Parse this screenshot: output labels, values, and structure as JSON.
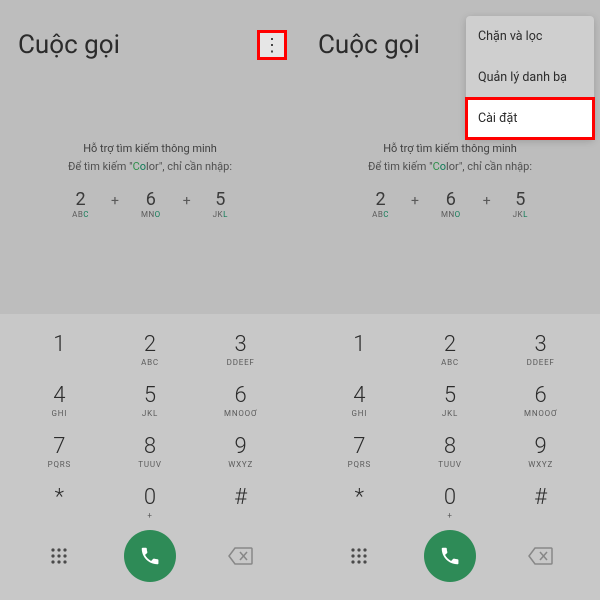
{
  "title": "Cuộc gọi",
  "hint": {
    "line1": "Hỗ trợ tìm kiếm thông minh",
    "line2_a": "Để tìm kiếm \"",
    "line2_b": "C",
    "line2_c": "o",
    "line2_d": "l",
    "line2_e": "or\", chỉ cần nhập:"
  },
  "example": [
    {
      "num": "2",
      "letters_pre": "AB",
      "letters_hi": "C",
      "letters_post": ""
    },
    {
      "num": "6",
      "letters_pre": "MN",
      "letters_hi": "O",
      "letters_post": ""
    },
    {
      "num": "5",
      "letters_pre": "JK",
      "letters_hi": "L",
      "letters_post": ""
    }
  ],
  "keys": [
    {
      "n": "1",
      "sub": ""
    },
    {
      "n": "2",
      "sub": "ABC"
    },
    {
      "n": "3",
      "sub": "DDEEF"
    },
    {
      "n": "4",
      "sub": "GHI"
    },
    {
      "n": "5",
      "sub": "JKL"
    },
    {
      "n": "6",
      "sub": "MNOOƠ"
    },
    {
      "n": "7",
      "sub": "PQRS"
    },
    {
      "n": "8",
      "sub": "TUUV"
    },
    {
      "n": "9",
      "sub": "WXYZ"
    },
    {
      "n": "*",
      "sub": ""
    },
    {
      "n": "0",
      "sub": "+"
    },
    {
      "n": "#",
      "sub": ""
    }
  ],
  "menu": {
    "item1": "Chặn và lọc",
    "item2": "Quản lý danh bạ",
    "item3": "Cài đặt"
  }
}
